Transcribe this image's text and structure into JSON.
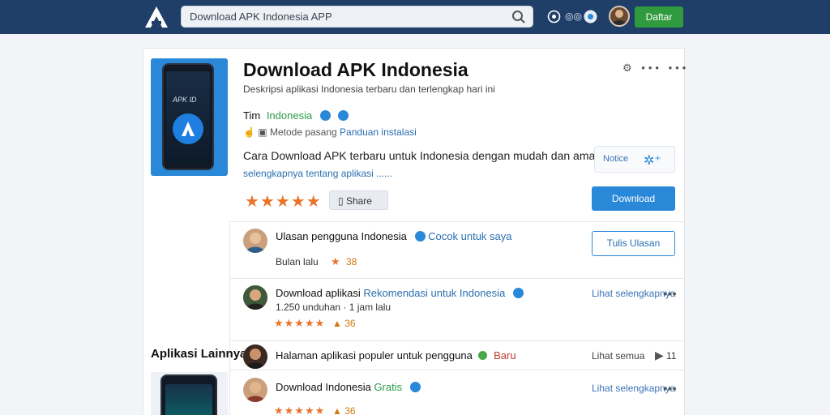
{
  "header": {
    "search_value": "Download APK Indonesia APP",
    "label": "◎◎",
    "button_label": "Daftar"
  },
  "app": {
    "title": "Download APK Indonesia",
    "subtitle": "Deskripsi aplikasi Indonesia terbaru dan terlengkap hari ini",
    "developer": "Tim",
    "developer_tag": "Indonesia",
    "meta": "Metode pasang",
    "meta_link": "Panduan instalasi",
    "description": "Cara Download APK terbaru untuk Indonesia dengan mudah dan aman gratis!",
    "description_more": "selengkapnya tentang aplikasi ......",
    "stars": "★★★★★",
    "share_label": "Share",
    "phone_label": "APK ID",
    "notice_label": "Notice",
    "primary_button": "Download"
  },
  "reviews": [
    {
      "name": "Ulasan pengguna Indonesia",
      "tag": "Cocok untuk saya",
      "meta": "Bulan lalu",
      "stars": "★",
      "score": "38",
      "side_button": "Tulis Ulasan"
    },
    {
      "name": "Download aplikasi",
      "tag": "Rekomendasi untuk Indonesia",
      "meta": "1.250 unduhan · 1 jam lalu",
      "stars": "★★★★★",
      "score": "36",
      "side_link": "Lihat selengkapnya"
    },
    {
      "name": "Halaman aplikasi populer untuk pengguna",
      "tag": "Baru",
      "side_link": "Lihat semua",
      "count": "11"
    },
    {
      "name": "Download Indonesia",
      "tag": "Gratis",
      "stars": "★★★★★",
      "score": "36",
      "side_link": "Lihat selengkapnya"
    }
  ],
  "sidebar": {
    "section_label": "Aplikasi Lainnya"
  },
  "colors": {
    "topbar": "#1f3e68",
    "accent": "#2a88d8",
    "cta_green": "#2f9a3e",
    "star": "#e8742c"
  },
  "icons": [
    "logo-icon",
    "search-icon",
    "settings-icon",
    "notification-icon",
    "share-icon",
    "verified-icon",
    "more-icon"
  ]
}
